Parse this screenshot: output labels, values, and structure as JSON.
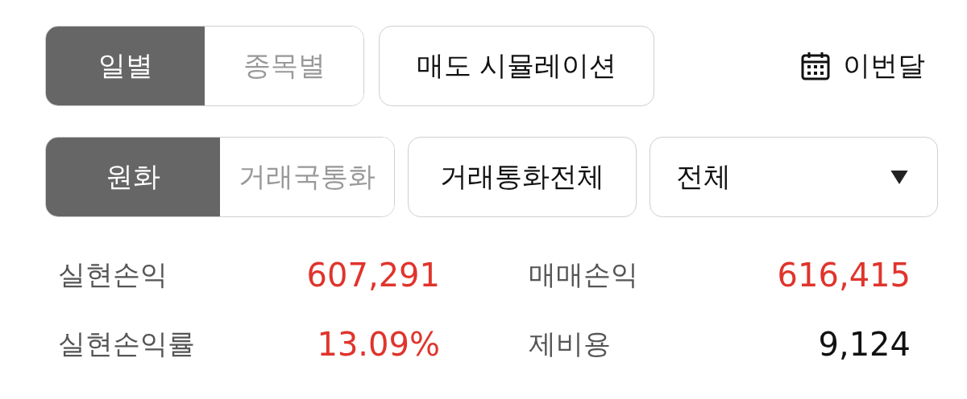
{
  "period_tabs": [
    {
      "label": "일별",
      "selected": true
    },
    {
      "label": "종목별",
      "selected": false
    }
  ],
  "sell_simulation_button": "매도 시뮬레이션",
  "date_range": {
    "label": "이번달"
  },
  "currency_tabs": [
    {
      "label": "원화",
      "selected": true
    },
    {
      "label": "거래국통화",
      "selected": false
    }
  ],
  "currency_filter_button": "거래통화전체",
  "market_dropdown": {
    "value": "전체"
  },
  "summary": [
    {
      "label": "실현손익",
      "value": "607,291",
      "color": "#e0342c"
    },
    {
      "label": "매매손익",
      "value": "616,415",
      "color": "#e0342c"
    },
    {
      "label": "실현손익률",
      "value": "13.09%",
      "color": "#e0342c"
    },
    {
      "label": "제비용",
      "value": "9,124",
      "color": "#111111"
    }
  ]
}
